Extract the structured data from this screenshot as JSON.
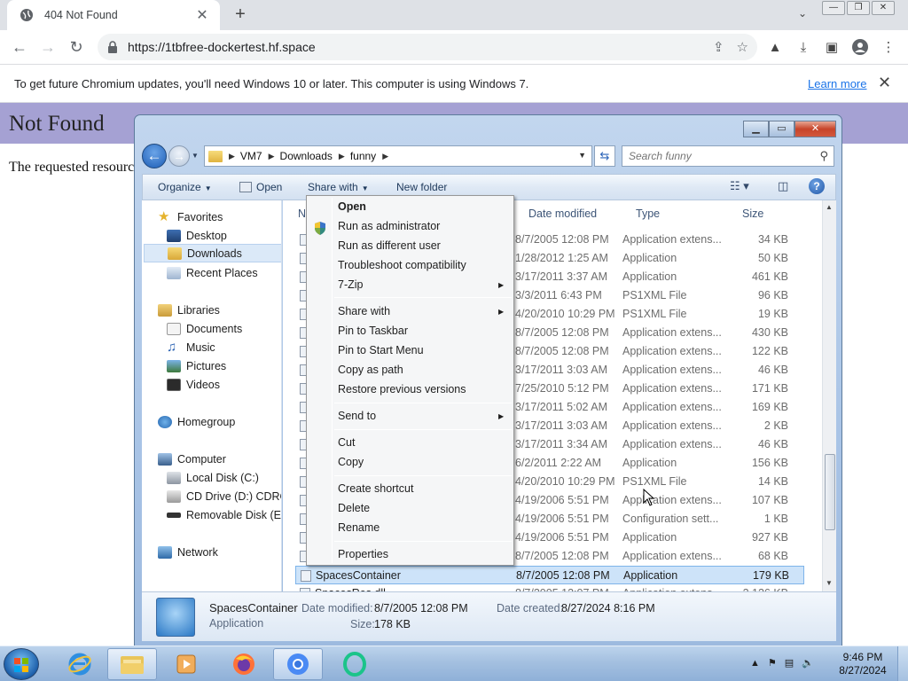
{
  "browser": {
    "tab_title": "404 Not Found",
    "new_tab": "+",
    "url": "https://1tbfree-dockertest.hf.space",
    "infobar_message": "To get future Chromium updates, you'll need Windows 10 or later. This computer is using Windows 7.",
    "infobar_link": "Learn more"
  },
  "page": {
    "heading": "Not Found",
    "description": "The requested resource"
  },
  "explorer": {
    "breadcrumbs": [
      "VM7",
      "Downloads",
      "funny"
    ],
    "search_placeholder": "Search funny",
    "commands": {
      "organize": "Organize",
      "open": "Open",
      "share_with": "Share with",
      "new_folder": "New folder"
    },
    "nav": {
      "favorites": "Favorites",
      "desktop": "Desktop",
      "downloads": "Downloads",
      "recent_places": "Recent Places",
      "libraries": "Libraries",
      "documents": "Documents",
      "music": "Music",
      "pictures": "Pictures",
      "videos": "Videos",
      "homegroup": "Homegroup",
      "computer": "Computer",
      "local_disk": "Local Disk (C:)",
      "cd_drive": "CD Drive (D:) CDROM",
      "removable_disk": "Removable Disk (E:)",
      "network": "Network"
    },
    "columns": {
      "name": "Name",
      "date_modified": "Date modified",
      "type": "Type",
      "size": "Size"
    },
    "files": [
      {
        "name": "",
        "date": "8/7/2005 12:08 PM",
        "type": "Application extens...",
        "size": "34 KB"
      },
      {
        "name": "",
        "date": "1/28/2012 1:25 AM",
        "type": "Application",
        "size": "50 KB"
      },
      {
        "name": "",
        "date": "3/17/2011 3:37 AM",
        "type": "Application",
        "size": "461 KB"
      },
      {
        "name": "",
        "date": "3/3/2011 6:43 PM",
        "type": "PS1XML File",
        "size": "96 KB"
      },
      {
        "name": "",
        "date": "4/20/2010 10:29 PM",
        "type": "PS1XML File",
        "size": "19 KB"
      },
      {
        "name": "",
        "date": "8/7/2005 12:08 PM",
        "type": "Application extens...",
        "size": "430 KB"
      },
      {
        "name": "",
        "date": "8/7/2005 12:08 PM",
        "type": "Application extens...",
        "size": "122 KB"
      },
      {
        "name": "",
        "date": "3/17/2011 3:03 AM",
        "type": "Application extens...",
        "size": "46 KB"
      },
      {
        "name": "",
        "date": "7/25/2010 5:12 PM",
        "type": "Application extens...",
        "size": "171 KB"
      },
      {
        "name": "",
        "date": "3/17/2011 5:02 AM",
        "type": "Application extens...",
        "size": "169 KB"
      },
      {
        "name": "",
        "date": "3/17/2011 3:03 AM",
        "type": "Application extens...",
        "size": "2 KB"
      },
      {
        "name": "",
        "date": "3/17/2011 3:34 AM",
        "type": "Application extens...",
        "size": "46 KB"
      },
      {
        "name": "",
        "date": "6/2/2011 2:22 AM",
        "type": "Application",
        "size": "156 KB"
      },
      {
        "name": "",
        "date": "4/20/2010 10:29 PM",
        "type": "PS1XML File",
        "size": "14 KB"
      },
      {
        "name": "",
        "date": "4/19/2006 5:51 PM",
        "type": "Application extens...",
        "size": "107 KB"
      },
      {
        "name": "",
        "date": "4/19/2006 5:51 PM",
        "type": "Configuration sett...",
        "size": "1 KB"
      },
      {
        "name": "",
        "date": "4/19/2006 5:51 PM",
        "type": "Application",
        "size": "927 KB"
      },
      {
        "name": "",
        "date": "8/7/2005 12:08 PM",
        "type": "Application extens...",
        "size": "68 KB"
      },
      {
        "name": "SpacesContainer",
        "date": "8/7/2005 12:08 PM",
        "type": "Application",
        "size": "179 KB"
      },
      {
        "name": "SpacesRes.dll",
        "date": "8/7/2005 12:07 PM",
        "type": "Application extens...",
        "size": "2,126 KB"
      }
    ],
    "details": {
      "name": "SpacesContainer",
      "type": "Application",
      "date_modified_label": "Date modified:",
      "date_modified": "8/7/2005 12:08 PM",
      "date_created_label": "Date created:",
      "date_created": "8/27/2024 8:16 PM",
      "size_label": "Size:",
      "size": "178 KB"
    }
  },
  "context_menu": {
    "open": "Open",
    "run_as_admin": "Run as administrator",
    "run_as_different": "Run as different user",
    "troubleshoot": "Troubleshoot compatibility",
    "sevenzip": "7-Zip",
    "share_with": "Share with",
    "pin_taskbar": "Pin to Taskbar",
    "pin_start": "Pin to Start Menu",
    "copy_as_path": "Copy as path",
    "restore_versions": "Restore previous versions",
    "send_to": "Send to",
    "cut": "Cut",
    "copy": "Copy",
    "create_shortcut": "Create shortcut",
    "delete": "Delete",
    "rename": "Rename",
    "properties": "Properties"
  },
  "taskbar": {
    "time": "9:46 PM",
    "date": "8/27/2024"
  },
  "colors": {
    "page_header": "#a5a1d3",
    "link": "#1a73e8",
    "selection": "#cde3f9",
    "window_frame": "#a9c4e6"
  }
}
